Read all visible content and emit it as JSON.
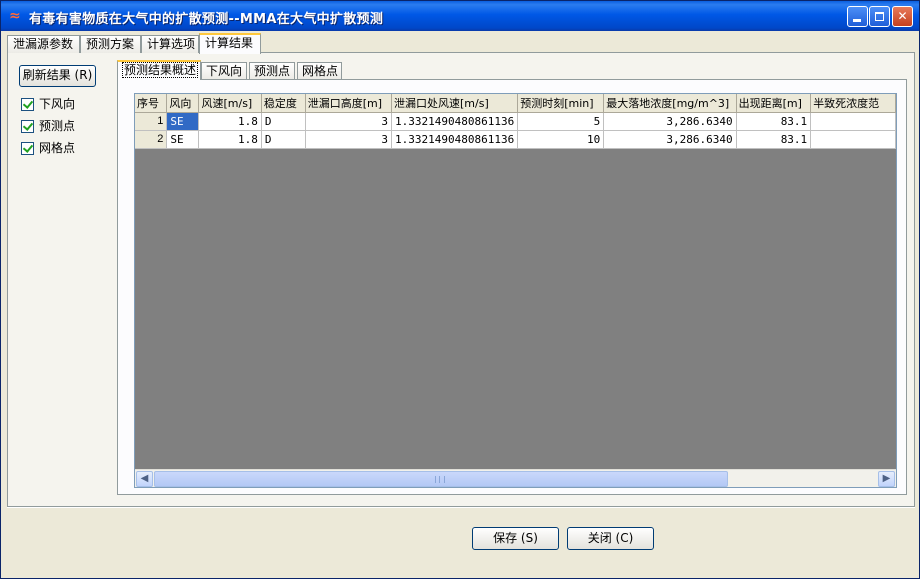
{
  "window": {
    "title": "有毒有害物质在大气中的扩散预测--MMA在大气中扩散预测",
    "icon": "app-icon",
    "controls": [
      "minimize",
      "maximize",
      "close"
    ]
  },
  "outer_tabs": [
    {
      "label": "泄漏源参数",
      "active": false
    },
    {
      "label": "预测方案",
      "active": false
    },
    {
      "label": "计算选项",
      "active": false
    },
    {
      "label": "计算结果",
      "active": true
    }
  ],
  "left_panel": {
    "refresh_label": "刷新结果 (R)",
    "checkboxes": [
      {
        "label": "下风向",
        "checked": true
      },
      {
        "label": "预测点",
        "checked": true
      },
      {
        "label": "网格点",
        "checked": true
      }
    ]
  },
  "inner_tabs": [
    {
      "label": "预测结果概述",
      "active": true
    },
    {
      "label": "下风向",
      "active": false
    },
    {
      "label": "预测点",
      "active": false
    },
    {
      "label": "网格点",
      "active": false
    }
  ],
  "table": {
    "columns": [
      "序号",
      "风向",
      "风速[m/s]",
      "稳定度",
      "泄漏口高度[m]",
      "泄漏口处风速[m/s]",
      "预测时刻[min]",
      "最大落地浓度[mg/m^3]",
      "出现距离[m]",
      "半致死浓度范"
    ],
    "rows": [
      [
        "1",
        "SE",
        "1.8",
        "D",
        "3",
        "1.3321490480861136",
        "5",
        "3,286.6340",
        "83.1",
        ""
      ],
      [
        "2",
        "SE",
        "1.8",
        "D",
        "3",
        "1.3321490480861136",
        "10",
        "3,286.6340",
        "83.1",
        ""
      ]
    ]
  },
  "buttons": {
    "save": "保存 (S)",
    "close": "关闭 (C)"
  }
}
